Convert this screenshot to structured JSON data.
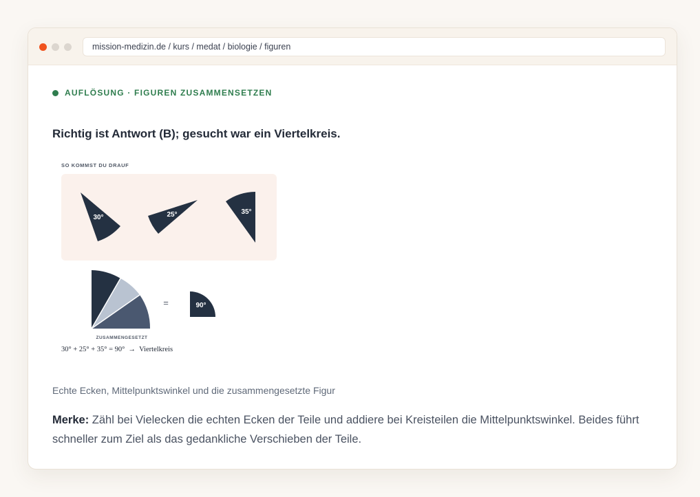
{
  "browser": {
    "url": "mission-medizin.de  /  kurs / medat / biologie / figuren"
  },
  "section": {
    "eyebrow": "AUFLÖSUNG · FIGUREN ZUSAMMENSETZEN"
  },
  "answer": {
    "headline": "Richtig ist Antwort (B); gesucht war ein Viertelkreis."
  },
  "figure": {
    "label": "SO KOMMST DU DRAUF",
    "pieces": [
      "30°",
      "25°",
      "35°"
    ],
    "equals": "=",
    "result": "90°",
    "composite_label": "ZUSAMMENGESETZT",
    "formula": "30° + 25° + 35° = 90°  →  Viertelkreis"
  },
  "caption": "Echte Ecken, Mittelpunktswinkel und die zusammengesetzte Figur",
  "note": {
    "label": "Merke:",
    "text": " Zähl bei Vielecken die echten Ecken der Teile und addiere bei Kreisteilen die Mittelpunktswinkel. Beides führt schneller zum Ziel als das gedankliche Verschieben der Teile."
  },
  "colors": {
    "accent": "#2f7d4e",
    "close_dot": "#f0531e",
    "sector_dark": "#243142",
    "sector_light": "#b9c3d1",
    "sector_mid": "#4a5870",
    "panel_bg": "#fbf1ec"
  }
}
